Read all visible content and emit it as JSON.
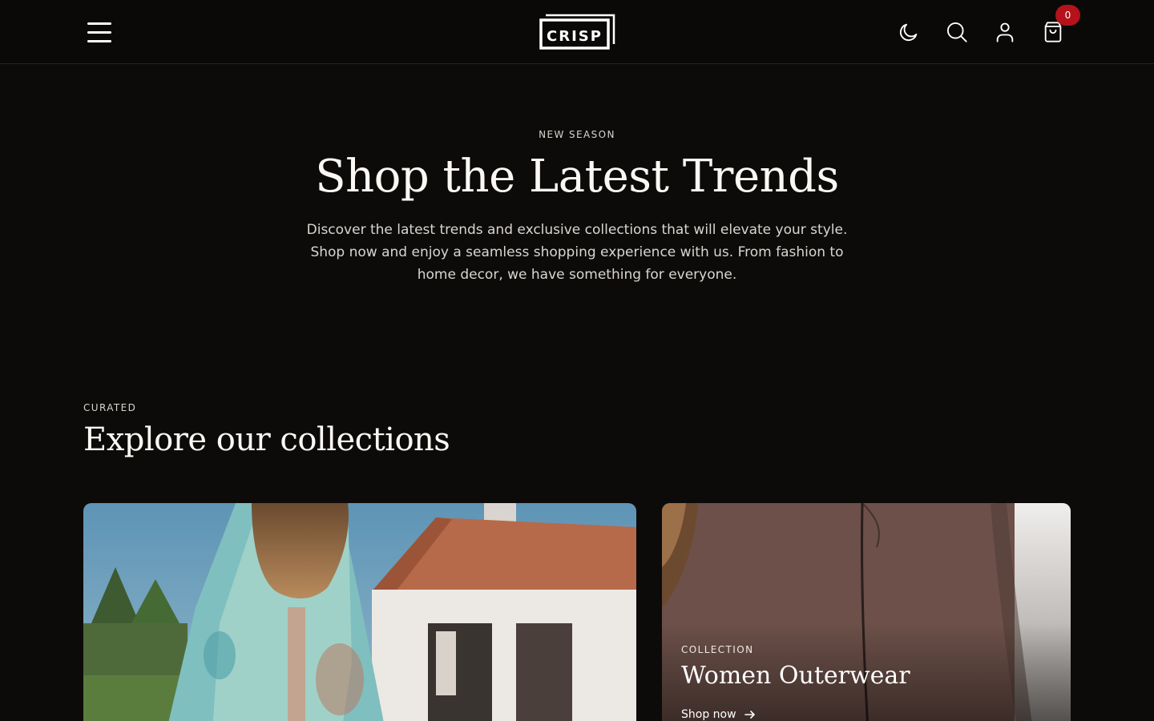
{
  "header": {
    "logo_text": "CRISP",
    "cart_count": "0",
    "icons": [
      "menu-icon",
      "moon-icon",
      "search-icon",
      "user-icon",
      "cart-icon"
    ]
  },
  "hero": {
    "eyebrow": "NEW SEASON",
    "title": "Shop the Latest Trends",
    "description": "Discover the latest trends and exclusive collections that will elevate your style. Shop now and enjoy a seamless shopping experience with us. From fashion to home decor, we have something for everyone."
  },
  "collections": {
    "eyebrow": "CURATED",
    "title": "Explore our collections",
    "cards": [
      {
        "label": "",
        "title": "",
        "cta": ""
      },
      {
        "label": "COLLECTION",
        "title": "Women Outerwear",
        "cta": "Shop now"
      }
    ]
  },
  "colors": {
    "background": "#0d0b0a",
    "header_background": "#0a0908",
    "text": "#f3f1ee",
    "badge": "#b5121b"
  }
}
